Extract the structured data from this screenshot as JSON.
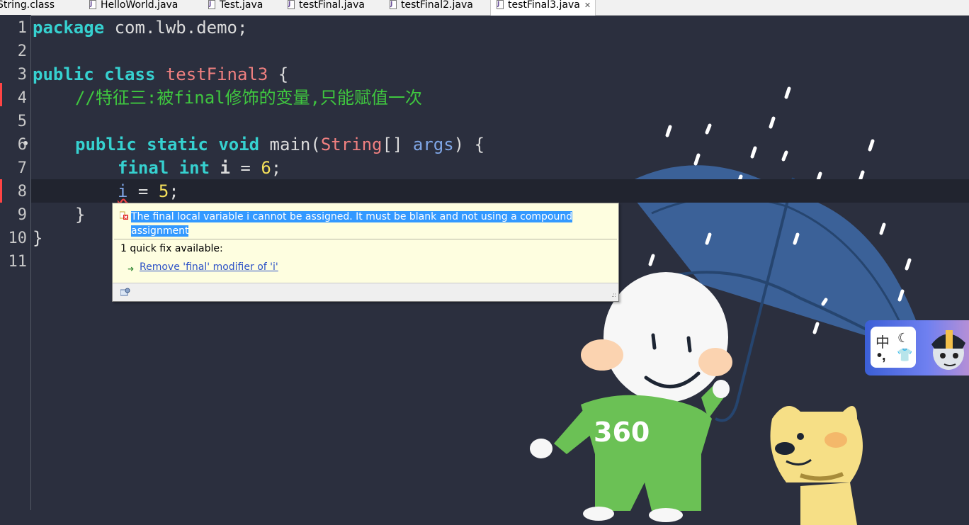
{
  "tabs": [
    {
      "label": "String.class",
      "active": false
    },
    {
      "label": "HelloWorld.java",
      "active": false
    },
    {
      "label": "Test.java",
      "active": false
    },
    {
      "label": "testFinal.java",
      "active": false
    },
    {
      "label": "testFinal2.java",
      "active": false
    },
    {
      "label": "testFinal3.java",
      "active": true
    }
  ],
  "close_glyph": "✕",
  "line_numbers": [
    "1",
    "2",
    "3",
    "4",
    "5",
    "6",
    "7",
    "8",
    "9",
    "10",
    "11"
  ],
  "code": {
    "l1": {
      "kw": "package",
      "rest": " com.lwb.demo;"
    },
    "l3": {
      "kw1": "public",
      "kw2": "class",
      "name": "testFinal3",
      "brace": " {"
    },
    "l4": {
      "comment": "//特征三:被final修饰的变量,只能赋值一次"
    },
    "l6": {
      "kw1": "public",
      "kw2": "static",
      "kw3": "void",
      "method": " main(",
      "type": "String",
      "arr": "[] ",
      "param": "args",
      "end": ") {"
    },
    "l7": {
      "kw1": "final",
      "kw2": "int",
      "var": "i",
      "eq": " = ",
      "num": "6",
      "semi": ";"
    },
    "l8": {
      "var": "i",
      "eq": " = ",
      "num": "5",
      "semi": ";"
    },
    "l9": {
      "brace": "}"
    },
    "l10": {
      "brace": "}"
    }
  },
  "popup": {
    "message": "The final local variable i cannot be assigned. It must be blank and not using a compound assignment",
    "quick_fix_count": "1 quick fix available:",
    "fix_label": "Remove 'final' modifier of 'i'",
    "fix_icon": "➜",
    "grip": ".::"
  },
  "ime": {
    "char": "中",
    "moon": "☾",
    "punct": "•,",
    "shirt": "👕"
  },
  "art": {
    "badge": "360"
  },
  "colors": {
    "background": "#2b2f3e",
    "keyword": "#36d1d0",
    "class_name": "#f08080",
    "number": "#f5e05a",
    "comment": "#3fc73f",
    "popup_bg": "#fefee0",
    "selection": "#3399ff",
    "link": "#2d52c7"
  }
}
